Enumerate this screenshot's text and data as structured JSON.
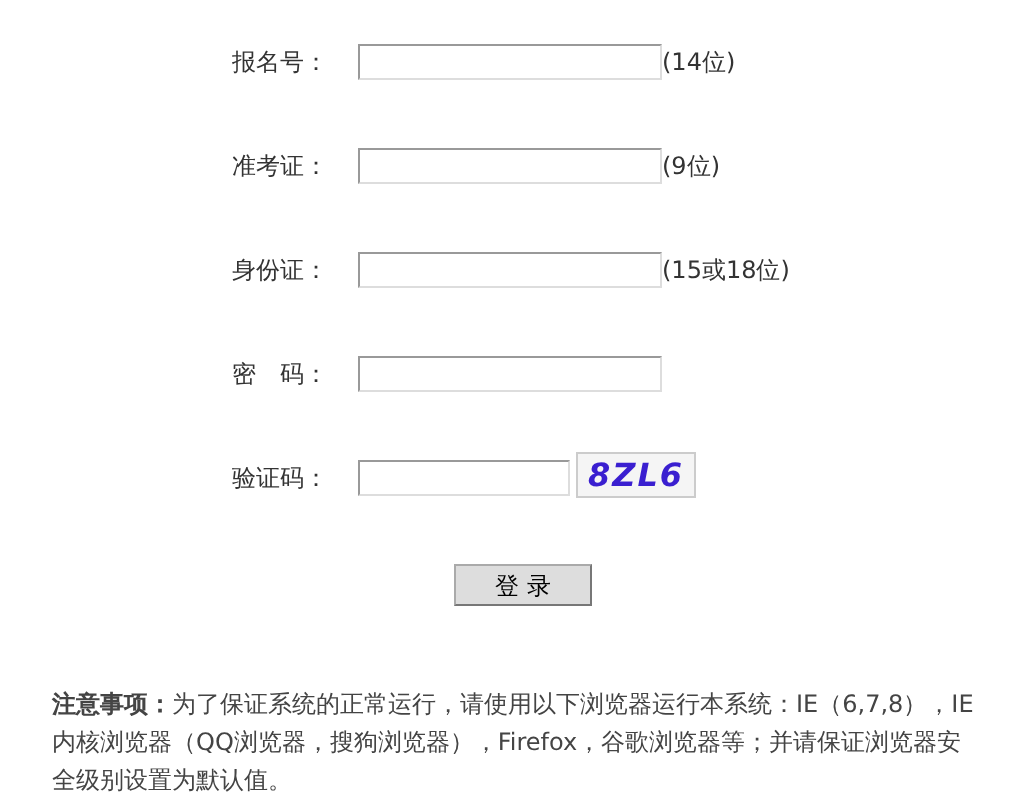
{
  "fields": [
    {
      "label": "报名号：",
      "hint": "(14位)"
    },
    {
      "label": "准考证：",
      "hint": "(9位)"
    },
    {
      "label": "身份证：",
      "hint": "(15或18位)"
    },
    {
      "label": "密　码：",
      "kind": "password"
    },
    {
      "label": "验证码：",
      "kind": "captcha",
      "captcha": "8ZL6"
    }
  ],
  "login_button": "登 录",
  "notice": "**注意事项：**为了保证系统的正常运行，请使用以下浏览器运行本系统：IE（6,7,8），IE内核浏览器（QQ浏览器，搜狗浏览器），Firefox，谷歌浏览器等；并请保证浏览器安全级别设置为默认值。"
}
